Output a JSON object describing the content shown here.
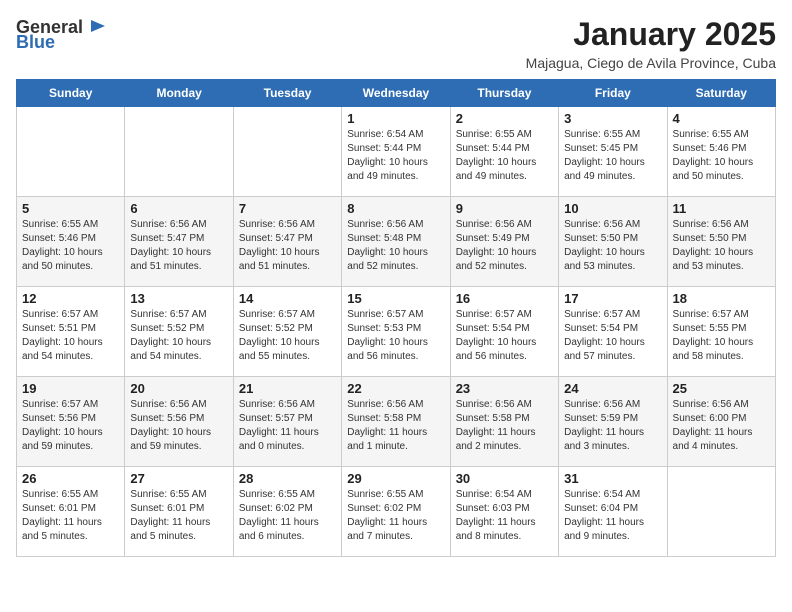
{
  "header": {
    "logo_general": "General",
    "logo_blue": "Blue",
    "title": "January 2025",
    "subtitle": "Majagua, Ciego de Avila Province, Cuba"
  },
  "weekdays": [
    "Sunday",
    "Monday",
    "Tuesday",
    "Wednesday",
    "Thursday",
    "Friday",
    "Saturday"
  ],
  "weeks": [
    [
      {
        "day": "",
        "sunrise": "",
        "sunset": "",
        "daylight": ""
      },
      {
        "day": "",
        "sunrise": "",
        "sunset": "",
        "daylight": ""
      },
      {
        "day": "",
        "sunrise": "",
        "sunset": "",
        "daylight": ""
      },
      {
        "day": "1",
        "sunrise": "Sunrise: 6:54 AM",
        "sunset": "Sunset: 5:44 PM",
        "daylight": "Daylight: 10 hours and 49 minutes."
      },
      {
        "day": "2",
        "sunrise": "Sunrise: 6:55 AM",
        "sunset": "Sunset: 5:44 PM",
        "daylight": "Daylight: 10 hours and 49 minutes."
      },
      {
        "day": "3",
        "sunrise": "Sunrise: 6:55 AM",
        "sunset": "Sunset: 5:45 PM",
        "daylight": "Daylight: 10 hours and 49 minutes."
      },
      {
        "day": "4",
        "sunrise": "Sunrise: 6:55 AM",
        "sunset": "Sunset: 5:46 PM",
        "daylight": "Daylight: 10 hours and 50 minutes."
      }
    ],
    [
      {
        "day": "5",
        "sunrise": "Sunrise: 6:55 AM",
        "sunset": "Sunset: 5:46 PM",
        "daylight": "Daylight: 10 hours and 50 minutes."
      },
      {
        "day": "6",
        "sunrise": "Sunrise: 6:56 AM",
        "sunset": "Sunset: 5:47 PM",
        "daylight": "Daylight: 10 hours and 51 minutes."
      },
      {
        "day": "7",
        "sunrise": "Sunrise: 6:56 AM",
        "sunset": "Sunset: 5:47 PM",
        "daylight": "Daylight: 10 hours and 51 minutes."
      },
      {
        "day": "8",
        "sunrise": "Sunrise: 6:56 AM",
        "sunset": "Sunset: 5:48 PM",
        "daylight": "Daylight: 10 hours and 52 minutes."
      },
      {
        "day": "9",
        "sunrise": "Sunrise: 6:56 AM",
        "sunset": "Sunset: 5:49 PM",
        "daylight": "Daylight: 10 hours and 52 minutes."
      },
      {
        "day": "10",
        "sunrise": "Sunrise: 6:56 AM",
        "sunset": "Sunset: 5:50 PM",
        "daylight": "Daylight: 10 hours and 53 minutes."
      },
      {
        "day": "11",
        "sunrise": "Sunrise: 6:56 AM",
        "sunset": "Sunset: 5:50 PM",
        "daylight": "Daylight: 10 hours and 53 minutes."
      }
    ],
    [
      {
        "day": "12",
        "sunrise": "Sunrise: 6:57 AM",
        "sunset": "Sunset: 5:51 PM",
        "daylight": "Daylight: 10 hours and 54 minutes."
      },
      {
        "day": "13",
        "sunrise": "Sunrise: 6:57 AM",
        "sunset": "Sunset: 5:52 PM",
        "daylight": "Daylight: 10 hours and 54 minutes."
      },
      {
        "day": "14",
        "sunrise": "Sunrise: 6:57 AM",
        "sunset": "Sunset: 5:52 PM",
        "daylight": "Daylight: 10 hours and 55 minutes."
      },
      {
        "day": "15",
        "sunrise": "Sunrise: 6:57 AM",
        "sunset": "Sunset: 5:53 PM",
        "daylight": "Daylight: 10 hours and 56 minutes."
      },
      {
        "day": "16",
        "sunrise": "Sunrise: 6:57 AM",
        "sunset": "Sunset: 5:54 PM",
        "daylight": "Daylight: 10 hours and 56 minutes."
      },
      {
        "day": "17",
        "sunrise": "Sunrise: 6:57 AM",
        "sunset": "Sunset: 5:54 PM",
        "daylight": "Daylight: 10 hours and 57 minutes."
      },
      {
        "day": "18",
        "sunrise": "Sunrise: 6:57 AM",
        "sunset": "Sunset: 5:55 PM",
        "daylight": "Daylight: 10 hours and 58 minutes."
      }
    ],
    [
      {
        "day": "19",
        "sunrise": "Sunrise: 6:57 AM",
        "sunset": "Sunset: 5:56 PM",
        "daylight": "Daylight: 10 hours and 59 minutes."
      },
      {
        "day": "20",
        "sunrise": "Sunrise: 6:56 AM",
        "sunset": "Sunset: 5:56 PM",
        "daylight": "Daylight: 10 hours and 59 minutes."
      },
      {
        "day": "21",
        "sunrise": "Sunrise: 6:56 AM",
        "sunset": "Sunset: 5:57 PM",
        "daylight": "Daylight: 11 hours and 0 minutes."
      },
      {
        "day": "22",
        "sunrise": "Sunrise: 6:56 AM",
        "sunset": "Sunset: 5:58 PM",
        "daylight": "Daylight: 11 hours and 1 minute."
      },
      {
        "day": "23",
        "sunrise": "Sunrise: 6:56 AM",
        "sunset": "Sunset: 5:58 PM",
        "daylight": "Daylight: 11 hours and 2 minutes."
      },
      {
        "day": "24",
        "sunrise": "Sunrise: 6:56 AM",
        "sunset": "Sunset: 5:59 PM",
        "daylight": "Daylight: 11 hours and 3 minutes."
      },
      {
        "day": "25",
        "sunrise": "Sunrise: 6:56 AM",
        "sunset": "Sunset: 6:00 PM",
        "daylight": "Daylight: 11 hours and 4 minutes."
      }
    ],
    [
      {
        "day": "26",
        "sunrise": "Sunrise: 6:55 AM",
        "sunset": "Sunset: 6:01 PM",
        "daylight": "Daylight: 11 hours and 5 minutes."
      },
      {
        "day": "27",
        "sunrise": "Sunrise: 6:55 AM",
        "sunset": "Sunset: 6:01 PM",
        "daylight": "Daylight: 11 hours and 5 minutes."
      },
      {
        "day": "28",
        "sunrise": "Sunrise: 6:55 AM",
        "sunset": "Sunset: 6:02 PM",
        "daylight": "Daylight: 11 hours and 6 minutes."
      },
      {
        "day": "29",
        "sunrise": "Sunrise: 6:55 AM",
        "sunset": "Sunset: 6:02 PM",
        "daylight": "Daylight: 11 hours and 7 minutes."
      },
      {
        "day": "30",
        "sunrise": "Sunrise: 6:54 AM",
        "sunset": "Sunset: 6:03 PM",
        "daylight": "Daylight: 11 hours and 8 minutes."
      },
      {
        "day": "31",
        "sunrise": "Sunrise: 6:54 AM",
        "sunset": "Sunset: 6:04 PM",
        "daylight": "Daylight: 11 hours and 9 minutes."
      },
      {
        "day": "",
        "sunrise": "",
        "sunset": "",
        "daylight": ""
      }
    ]
  ]
}
